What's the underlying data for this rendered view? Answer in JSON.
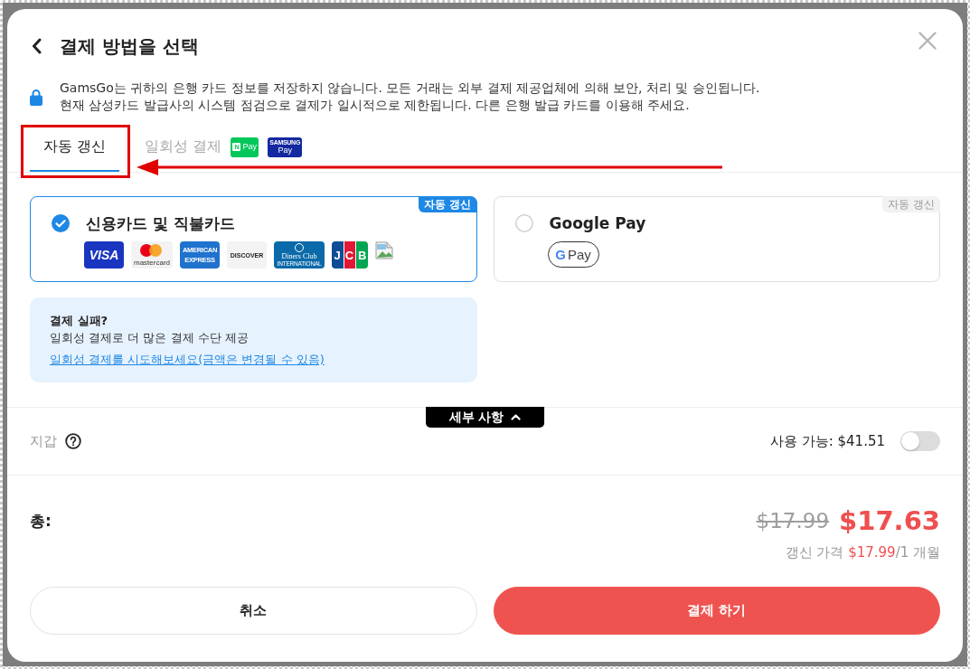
{
  "dialog": {
    "title": "결제 방법을 선택"
  },
  "notice": {
    "lines": [
      "GamsGo는 귀하의 은행 카드 정보를 저장하지 않습니다. 모든 거래는 외부 결제 제공업체에 의해 보안, 처리 및 승인됩니다.",
      "현재 삼성카드 발급사의 시스템 점검으로 결제가 일시적으로 제한됩니다. 다른 은행 발급 카드를 이용해 주세요."
    ]
  },
  "tabs": [
    {
      "label": "자동 갱신",
      "selected": true,
      "annotated": true
    },
    {
      "label": "일회성 결제",
      "selected": false,
      "annotated": false,
      "logos": [
        {
          "kind": "npay",
          "lines": [
            "N",
            "Pay"
          ]
        },
        {
          "kind": "samsung-pay",
          "lines": [
            "SAMSUNG",
            "Pay"
          ]
        }
      ]
    }
  ],
  "methods": [
    {
      "title": "신용카드 및 직불카드",
      "selected": true,
      "badge": "자동 갱신",
      "logos": [
        {
          "kind": "visa",
          "lines": [
            "VISA"
          ]
        },
        {
          "kind": "mastercard",
          "lines": [
            "mastercard"
          ]
        },
        {
          "kind": "amex",
          "lines": [
            "AMERICAN",
            "EXPRESS"
          ]
        },
        {
          "kind": "discover",
          "lines": [
            "DISCOVER"
          ]
        },
        {
          "kind": "diners",
          "lines": [
            "Diners Club",
            "INTERNATIONAL"
          ]
        },
        {
          "kind": "jcb",
          "lines": [
            "JCB"
          ]
        },
        {
          "kind": "broken-image"
        }
      ]
    },
    {
      "title": "Google Pay",
      "selected": false,
      "badge": "자동 갱신",
      "logos": [
        {
          "kind": "gpay",
          "lines": [
            "G",
            "Pay"
          ]
        }
      ]
    }
  ],
  "help": {
    "title": "결제 실패?",
    "text": "일회성 결제로 더 많은 결제 수단 제공",
    "link": "일회성 결제를 시도해보세요(금액은 변경될 수 있음)"
  },
  "details_toggle": {
    "label": "세부 사항",
    "expanded": true
  },
  "wallet": {
    "label": "지갑",
    "available": "사용 가능: $41.51",
    "on": false
  },
  "total": {
    "label": "총:",
    "original": "$17.99",
    "price": "$17.63",
    "renewal": {
      "prefix": "갱신 가격",
      "price": "$17.99",
      "suffix": "/1 개월"
    }
  },
  "buttons": [
    {
      "kind": "secondary",
      "label": "취소"
    },
    {
      "kind": "primary",
      "label": "결제 하기"
    }
  ]
}
